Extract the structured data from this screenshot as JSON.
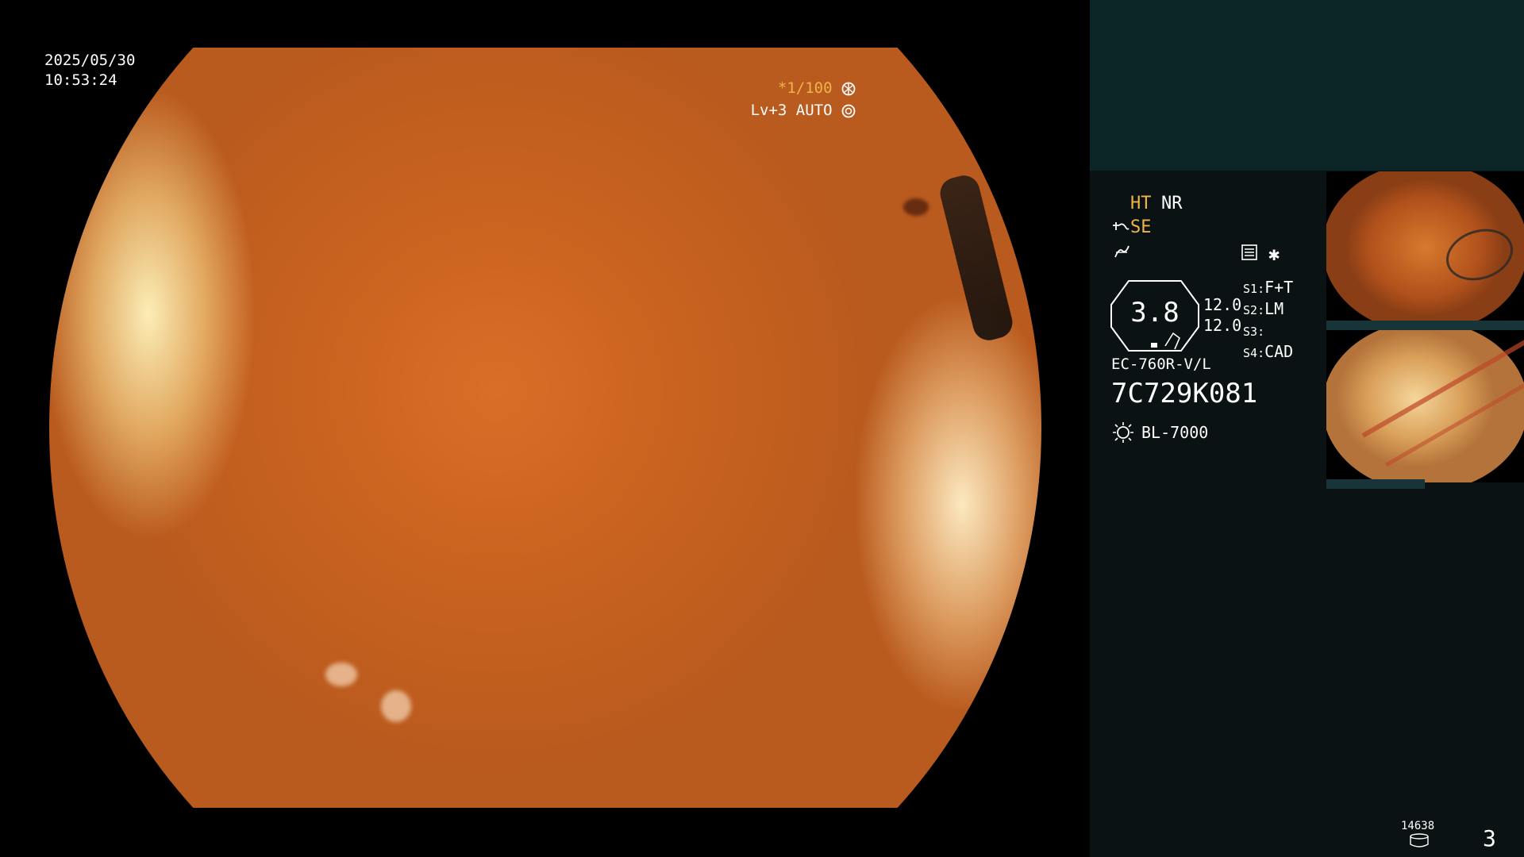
{
  "overlay": {
    "date": "2025/05/30",
    "time": "10:53:24",
    "shutter": "*1/100",
    "level": "Lv+3 AUTO"
  },
  "panel": {
    "ht": "HT",
    "nr": "NR",
    "se": "SE",
    "zoom_value": "3.8",
    "values": [
      "12.0",
      "12.0"
    ],
    "switches": [
      {
        "key": "S1",
        "value": "F+T"
      },
      {
        "key": "S2",
        "value": "LM"
      },
      {
        "key": "S3",
        "value": ""
      },
      {
        "key": "S4",
        "value": "CAD"
      }
    ],
    "scope_model": "EC-760R-V/L",
    "scope_serial": "7C729K081",
    "light_source": "BL-7000",
    "storage_count": "14638",
    "capture_count": "3"
  },
  "icons": {
    "shutter_icon": "aperture-icon",
    "level_icon": "iris-icon",
    "structure_icon": "wave-icon",
    "color_icon": "curve-icon",
    "menu_icon": "settings-list-icon",
    "star_icon": "asterisk-icon",
    "light_icon": "sun-icon",
    "storage_icon": "database-icon"
  },
  "colors": {
    "accent": "#f0b449",
    "panel_bg": "#0a1213",
    "panel_top_bg": "#0c2628",
    "text": "#ffffff"
  }
}
